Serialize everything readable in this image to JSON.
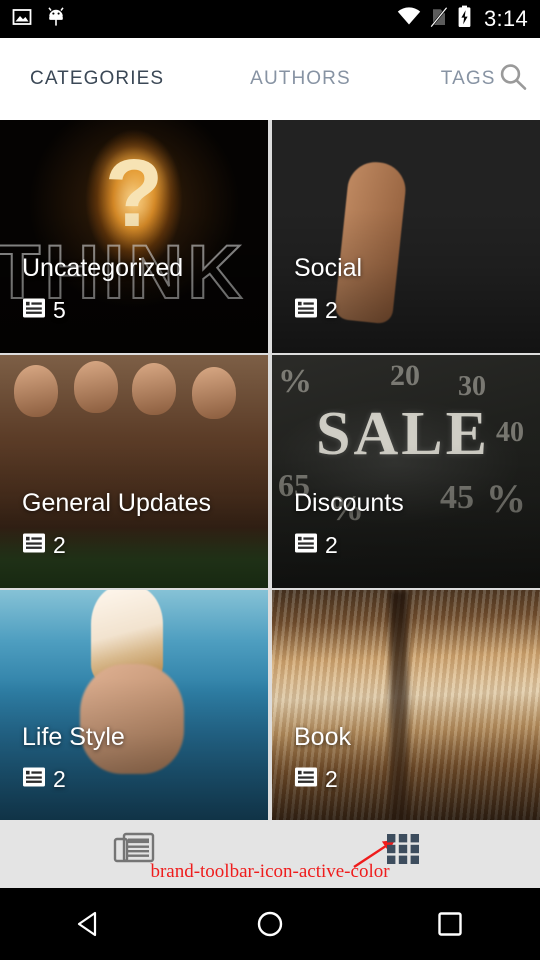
{
  "statusbar": {
    "time": "3:14",
    "icons": [
      "screenshot-icon",
      "android-debug-icon",
      "wifi-icon",
      "no-sim-icon",
      "battery-charging-icon"
    ]
  },
  "tabs": [
    {
      "label": "CATEGORIES",
      "active": true
    },
    {
      "label": "AUTHORS",
      "active": false
    },
    {
      "label": "TAGS",
      "active": false
    }
  ],
  "search": {
    "label": "search-icon"
  },
  "cards": [
    {
      "title": "Uncategorized",
      "count": "5",
      "image": "lightbulb-question-think"
    },
    {
      "title": "Social",
      "count": "2",
      "image": "social-media-icons-finger"
    },
    {
      "title": "General Updates",
      "count": "2",
      "image": "children-dolls-bench"
    },
    {
      "title": "Discounts",
      "count": "2",
      "image": "chalkboard-sale-percent"
    },
    {
      "title": "Life Style",
      "count": "2",
      "image": "ice-cream-cone-beach"
    },
    {
      "title": "Book",
      "count": "2",
      "image": "open-books-stack"
    }
  ],
  "bottom_toolbar": {
    "items": [
      {
        "name": "newspaper-icon",
        "active": false
      },
      {
        "name": "grid-view-icon",
        "active": true
      }
    ]
  },
  "annotation": {
    "text": "brand-toolbar-icon-active-color",
    "color": "#ef1c1c",
    "target": "grid-view-icon"
  },
  "colors": {
    "brand_toolbar_icon_active": "#3d4d5e",
    "toolbar_icon_inactive": "#757575",
    "tab_active": "#3b4856",
    "tab_inactive": "#8793a3",
    "toolbar_background": "#e4e4e4",
    "statusbar_background": "#000000",
    "tabbar_background": "#ffffff"
  },
  "navbar": {
    "buttons": [
      {
        "name": "back-button"
      },
      {
        "name": "home-button"
      },
      {
        "name": "recents-button"
      }
    ]
  },
  "sale_chalk": [
    "%",
    "20",
    "30",
    "40",
    "65",
    "45",
    "%",
    "%"
  ]
}
